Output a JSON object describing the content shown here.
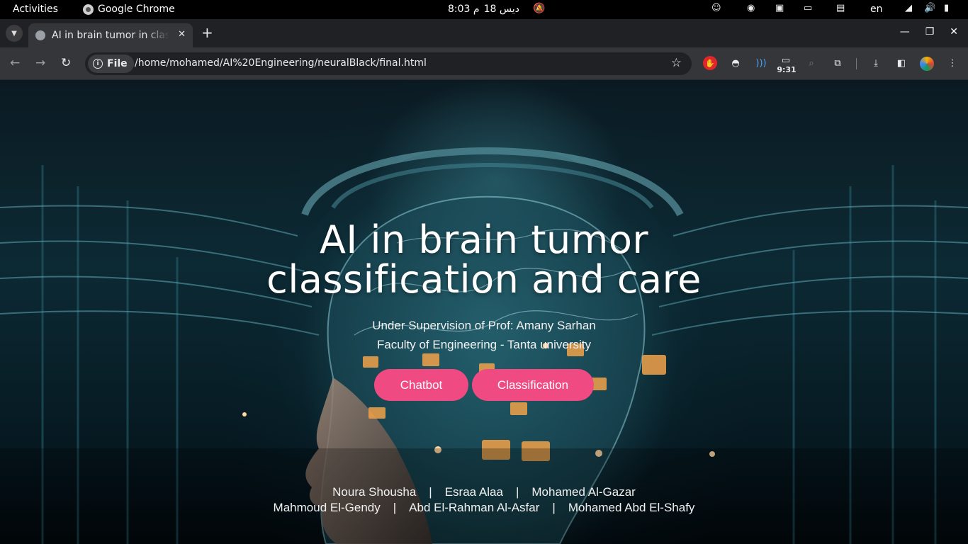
{
  "os_bar": {
    "activities": "Activities",
    "app_name": "Google Chrome",
    "clock_time": "8:03 م",
    "clock_date": "ديس 18",
    "language": "en"
  },
  "browser": {
    "tab_title": "AI in brain tumor in classification and care",
    "site_chip": "File",
    "url": "/home/mohamed/AI%20Engineering/neuralBlack/final.html",
    "extension_time": "9:31"
  },
  "hero": {
    "title_line1": "AI in brain tumor",
    "title_line2": "classification and care",
    "supervision": "Under Supervision of Prof: Amany Sarhan",
    "faculty": "Faculty of Engineering - Tanta university",
    "buttons": {
      "chatbot": "Chatbot",
      "classification": "Classification"
    },
    "team_row1": [
      "Noura Shousha",
      "Esraa Alaa",
      "Mohamed Al-Gazar"
    ],
    "team_row2": [
      "Mahmoud El-Gendy",
      "Abd El-Rahman Al-Asfar",
      "Mohamed Abd El-Shafy"
    ],
    "separator": "|"
  },
  "colors": {
    "accent_button": "#ef4a82",
    "chrome_dark": "#202124",
    "chrome_toolbar": "#35363a"
  }
}
